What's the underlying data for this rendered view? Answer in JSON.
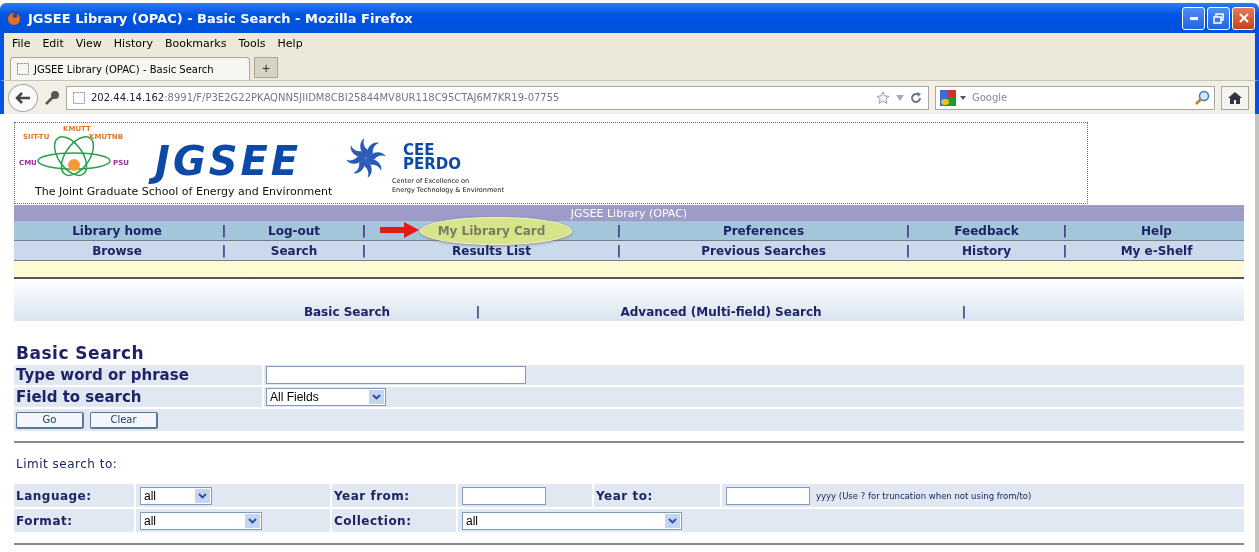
{
  "window": {
    "title": "JGSEE Library (OPAC) - Basic Search - Mozilla Firefox"
  },
  "menu": [
    "File",
    "Edit",
    "View",
    "History",
    "Bookmarks",
    "Tools",
    "Help"
  ],
  "tabs": [
    {
      "label": "JGSEE Library (OPAC) - Basic Search",
      "selected": true
    }
  ],
  "new_tab": "+",
  "url": {
    "host": "202.44.14.162",
    "path": ":8991/F/P3E2G22PKAQNN5JIIDM8CBI25844MV8UR118C95CTAJ6M7KR19-07755"
  },
  "search": {
    "placeholder": "Google"
  },
  "banner": {
    "partners": [
      "KMUTT",
      "SIIT-TU",
      "KMUTNB",
      "CMU",
      "PSU"
    ],
    "name": "JGSEE",
    "subtitle": "The Joint Graduate School of Energy and Environment",
    "cee": [
      "CEE",
      "PERDO"
    ],
    "cee_lines": [
      "Center of Excellence on",
      "Energy Technology & Environment"
    ]
  },
  "site_title": "JGSEE Library (OPAC)",
  "nav_separator": "|",
  "nav_rows": [
    [
      {
        "label": "Library home",
        "highlighted": false
      },
      {
        "label": "Log-out",
        "highlighted": false
      },
      {
        "label": "My Library Card",
        "highlighted": true
      },
      {
        "label": "Preferences",
        "highlighted": false
      },
      {
        "label": "Feedback",
        "highlighted": false
      },
      {
        "label": "Help",
        "highlighted": false
      }
    ],
    [
      {
        "label": "Browse",
        "highlighted": false
      },
      {
        "label": "Search",
        "highlighted": false
      },
      {
        "label": "Results List",
        "highlighted": false
      },
      {
        "label": "Previous Searches",
        "highlighted": false
      },
      {
        "label": "History",
        "highlighted": false
      },
      {
        "label": "My e-Shelf",
        "highlighted": false
      }
    ]
  ],
  "search_modes": [
    {
      "label": "Basic Search"
    },
    {
      "label": "Advanced (Multi-field) Search"
    }
  ],
  "heading": "Basic Search",
  "basic_fields": [
    {
      "kind": "input",
      "label": "Type word or phrase"
    },
    {
      "kind": "select",
      "label": "Field to search",
      "value": "All Fields"
    }
  ],
  "buttons": [
    "Go",
    "Clear"
  ],
  "limit_title": "Limit search to:",
  "limits": [
    [
      {
        "kind": "label",
        "text": "Language:"
      },
      {
        "kind": "select",
        "value": "all"
      },
      {
        "kind": "label",
        "text": "Year from:"
      },
      {
        "kind": "input"
      },
      {
        "kind": "label",
        "text": "Year to:"
      },
      {
        "kind": "input",
        "hint": "yyyy (Use ? for truncation when not using from/to)"
      }
    ],
    [
      {
        "kind": "label",
        "text": "Format:"
      },
      {
        "kind": "select",
        "value": "all"
      },
      {
        "kind": "label",
        "text": "Collection:"
      },
      {
        "kind": "select",
        "value": "all"
      }
    ]
  ]
}
